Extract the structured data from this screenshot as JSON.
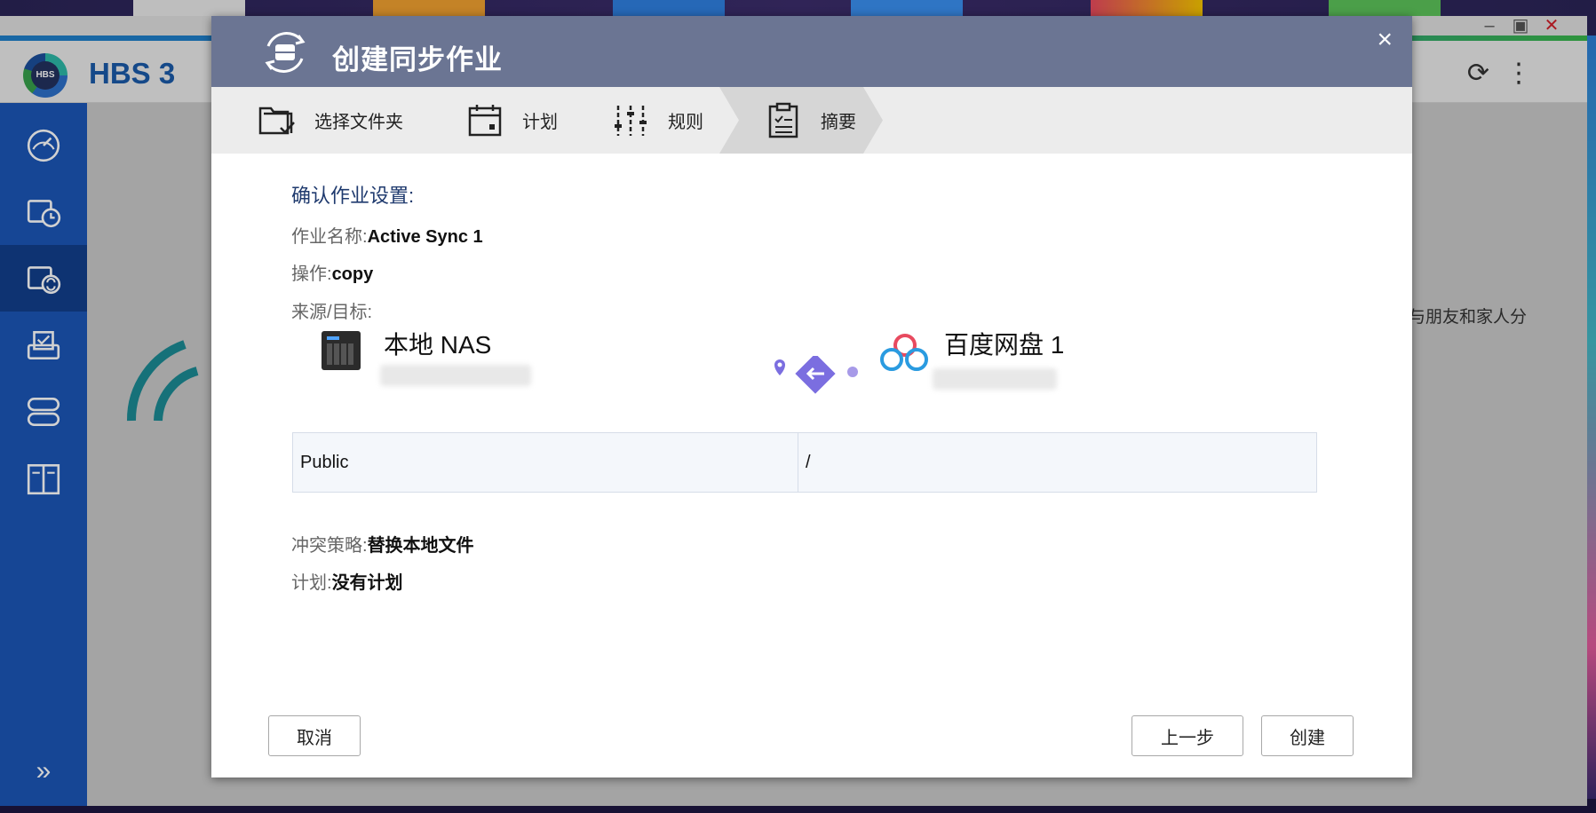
{
  "app": {
    "name": "HBS 3",
    "logo_text": "HBS",
    "content_text": "与朋友和家人分"
  },
  "modal": {
    "title": "创建同步作业",
    "close_glyph": "×",
    "steps": [
      {
        "label": "选择文件夹",
        "icon": "folder-check-icon"
      },
      {
        "label": "计划",
        "icon": "calendar-icon"
      },
      {
        "label": "规则",
        "icon": "sliders-icon"
      },
      {
        "label": "摘要",
        "icon": "clipboard-icon",
        "active": true
      }
    ],
    "summary": {
      "title": "确认作业设置:",
      "job_name_label": "作业名称:",
      "job_name_value": "Active Sync 1",
      "operation_label": "操作:",
      "operation_value": "copy",
      "source_target_label": "来源/目标:",
      "source_name": "本地 NAS",
      "target_name": "百度网盘 1",
      "source_path": "Public",
      "target_path": "/",
      "conflict_label": "冲突策略:",
      "conflict_value": "替换本地文件",
      "schedule_label": "计划:",
      "schedule_value": "没有计划"
    },
    "buttons": {
      "cancel": "取消",
      "previous": "上一步",
      "create": "创建"
    }
  },
  "colors": {
    "modal_header": "#6b7593",
    "sidebar": "#1b56b6",
    "sidebar_active": "#123f8c",
    "brand_blue": "#1a5aa8",
    "connector": "#7b6ee0"
  }
}
